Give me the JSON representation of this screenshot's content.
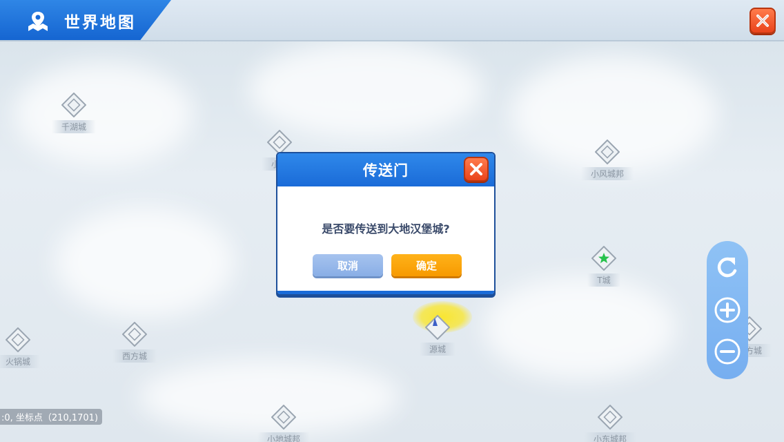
{
  "header": {
    "title": "世界地图",
    "map_icon": "map-pin-icon",
    "close_icon": "close-icon"
  },
  "markers": [
    {
      "name": "千湖城",
      "icon": "portal-diamond-icon"
    },
    {
      "name": "小…",
      "icon": "portal-diamond-icon"
    },
    {
      "name": "小风城邦",
      "icon": "portal-diamond-icon"
    },
    {
      "name": "T城",
      "icon": "portal-diamond-icon",
      "star": true
    },
    {
      "name": "火锅城",
      "icon": "portal-diamond-icon"
    },
    {
      "name": "西方城",
      "icon": "portal-diamond-icon"
    },
    {
      "name": "源城",
      "icon": "portal-diamond-icon",
      "current": true
    },
    {
      "name": "东方城",
      "icon": "portal-diamond-icon"
    },
    {
      "name": "小地城邦",
      "icon": "portal-diamond-icon"
    },
    {
      "name": "小东城邦",
      "icon": "portal-diamond-icon"
    }
  ],
  "coords": {
    "text": ":0, 坐标点（210,1701)"
  },
  "controls": {
    "reset_icon": "refresh-icon",
    "zoom_in_icon": "zoom-in-icon",
    "zoom_out_icon": "zoom-out-icon"
  },
  "dialog": {
    "title": "传送门",
    "message": "是否要传送到大地汉堡城?",
    "cancel_label": "取消",
    "confirm_label": "确定"
  },
  "colors": {
    "header_blue": "#1a6bd8",
    "close_orange": "#e9431b",
    "confirm_orange": "#f79a00",
    "cancel_blue": "#89aee6",
    "control_blue": "#76aef0",
    "star_green": "#27c24c",
    "player_glow": "#fae628"
  }
}
